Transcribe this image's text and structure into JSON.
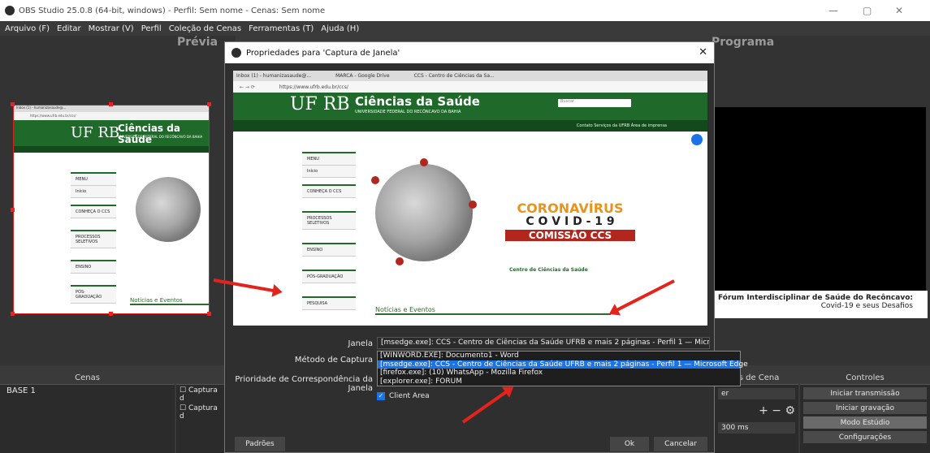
{
  "window": {
    "title": "OBS Studio 25.0.8 (64-bit, windows) - Perfil: Sem nome - Cenas: Sem nome",
    "minimize": "—",
    "maximize": "▢",
    "close": "✕"
  },
  "menu": [
    "Arquivo (F)",
    "Editar",
    "Mostrar (V)",
    "Perfil",
    "Coleção de Cenas",
    "Ferramentas (T)",
    "Ajuda (H)"
  ],
  "preview_label": "Prévia",
  "program_label": "Programa",
  "program_banner": {
    "line1": "Fórum Interdisciplinar de Saúde do Recôncavo:",
    "line2": "Covid-19 e seus Desafios"
  },
  "docks": {
    "cenas_title": "Cenas",
    "scenes": [
      "BASE 1"
    ],
    "sources": [
      "Captura d",
      "Captura d"
    ],
    "transicoes_title": "es de Cena",
    "transicao_value": "er",
    "duration": "300 ms",
    "controles_title": "Controles",
    "controls": [
      "Iniciar transmissão",
      "Iniciar gravação",
      "Modo Estúdio",
      "Configurações"
    ]
  },
  "dialog": {
    "title": "Propriedades para 'Captura de Janela'",
    "labels": {
      "janela": "Janela",
      "metodo": "Método de Captura",
      "prioridade": "Prioridade de Correspondência da Janela"
    },
    "janela_value": "[msedge.exe]: CCS - Centro de Ciências da Saúde UFRB e mais 2 páginas - Perfil 1 — Microsoft Edg",
    "options": [
      "[WINWORD.EXE]: Documento1 - Word",
      "[msedge.exe]: CCS - Centro de Ciências da Saúde UFRB e mais 2 páginas - Perfil 1 — Microsoft Edge",
      "[firefox.exe]: (10) WhatsApp - Mozilla Firefox",
      "[explorer.exe]: FORUM"
    ],
    "selected_index": 1,
    "client_area": "Client Area",
    "buttons": {
      "defaults": "Padrões",
      "ok": "Ok",
      "cancel": "Cancelar"
    }
  },
  "browser": {
    "tabs": [
      "Inbox (1) - humanizasaude@...",
      "MARCA - Google Drive",
      "CCS - Centro de Ciências da Sa..."
    ],
    "url": "https://www.ufrb.edu.br/ccs/",
    "site_logo": "UF RB",
    "site_title": "Ciências da Saúde",
    "site_subtitle": "UNIVERSIDADE FEDERAL DO RECÔNCAVO DA BAHIA",
    "search_placeholder": "Buscar",
    "nav": "Contato   Serviços da UFRB   Área de imprensa",
    "menu_items": [
      "MENU",
      "Início",
      "CONHEÇA O CCS",
      "PROCESSOS SELETIVOS",
      "ENSINO",
      "PÓS-GRADUAÇÃO",
      "PESQUISA"
    ],
    "covid_line1": "CORONAVÍRUS",
    "covid_line2": "C O V I D - 1 9",
    "covid_line3": "COMISSÃO CCS",
    "ccs_logo": "Centro de Ciências da Saúde",
    "noticias": "Notícias e Eventos"
  },
  "colors": {
    "accent": "#1a73e8",
    "site_green": "#1f6a2a",
    "covid_orange": "#e8941a",
    "covid_red": "#b3261e",
    "arrow_red": "#e4231b"
  }
}
